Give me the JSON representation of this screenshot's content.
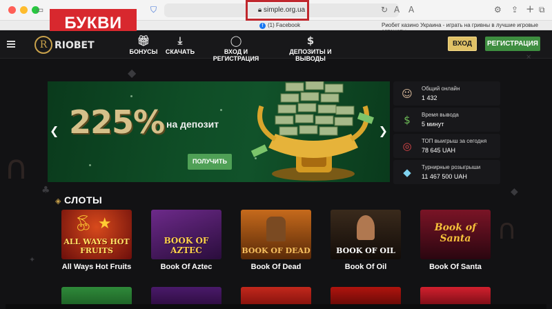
{
  "browser": {
    "url": "simple.org.ua",
    "tabs": [
      {
        "label": "(1) Facebook"
      },
      {
        "label": "Риобет казино Украина - играть на гривны в лучшие игровые автоматы"
      }
    ]
  },
  "badge": {
    "text": "БУКВИ"
  },
  "header": {
    "logo_text": "RIOBET",
    "nav": [
      {
        "label": "БОНУСЫ",
        "icon": "gift-icon"
      },
      {
        "label": "СКАЧАТЬ",
        "icon": "download-icon"
      },
      {
        "label": "ВХОД И РЕГИСТРАЦИЯ",
        "icon": "user-icon"
      },
      {
        "label": "ДЕПОЗИТЫ И ВЫВОДЫ",
        "icon": "dollar-icon"
      }
    ],
    "login_label": "ВХОД",
    "register_label": "РЕГИСТРАЦИЯ"
  },
  "promo": {
    "big_text": "225%",
    "sub_text": "на депозит",
    "button_label": "ПОЛУЧИТЬ"
  },
  "stats": [
    {
      "label": "Общий онлайн",
      "value": "1 432",
      "icon": "dealer-icon"
    },
    {
      "label": "Время вывода",
      "value": "5 минут",
      "icon": "money-bag-icon"
    },
    {
      "label": "ТОП выигрыш за сегодня",
      "value": "78 645 UAH",
      "icon": "target-icon"
    },
    {
      "label": "Турнирные розыгрыши",
      "value": "11 467 500 UAH",
      "icon": "diamond-icon"
    }
  ],
  "slots": {
    "title": "СЛОТЫ",
    "games": [
      {
        "name": "All Ways Hot Fruits",
        "art": "ALL WAYS HOT FRUITS"
      },
      {
        "name": "Book Of Aztec",
        "art": "BOOK OF AZTEC"
      },
      {
        "name": "Book Of Dead",
        "art": "BOOK OF DEAD"
      },
      {
        "name": "Book Of Oil",
        "art": "BOOK OF OIL"
      },
      {
        "name": "Book Of Santa",
        "art": "Book of Santa"
      }
    ]
  },
  "colors": {
    "accent_gold": "#e0c166",
    "register_green": "#3e8e40",
    "badge_red": "#d8282e",
    "banner_green": "#0f4d26"
  }
}
